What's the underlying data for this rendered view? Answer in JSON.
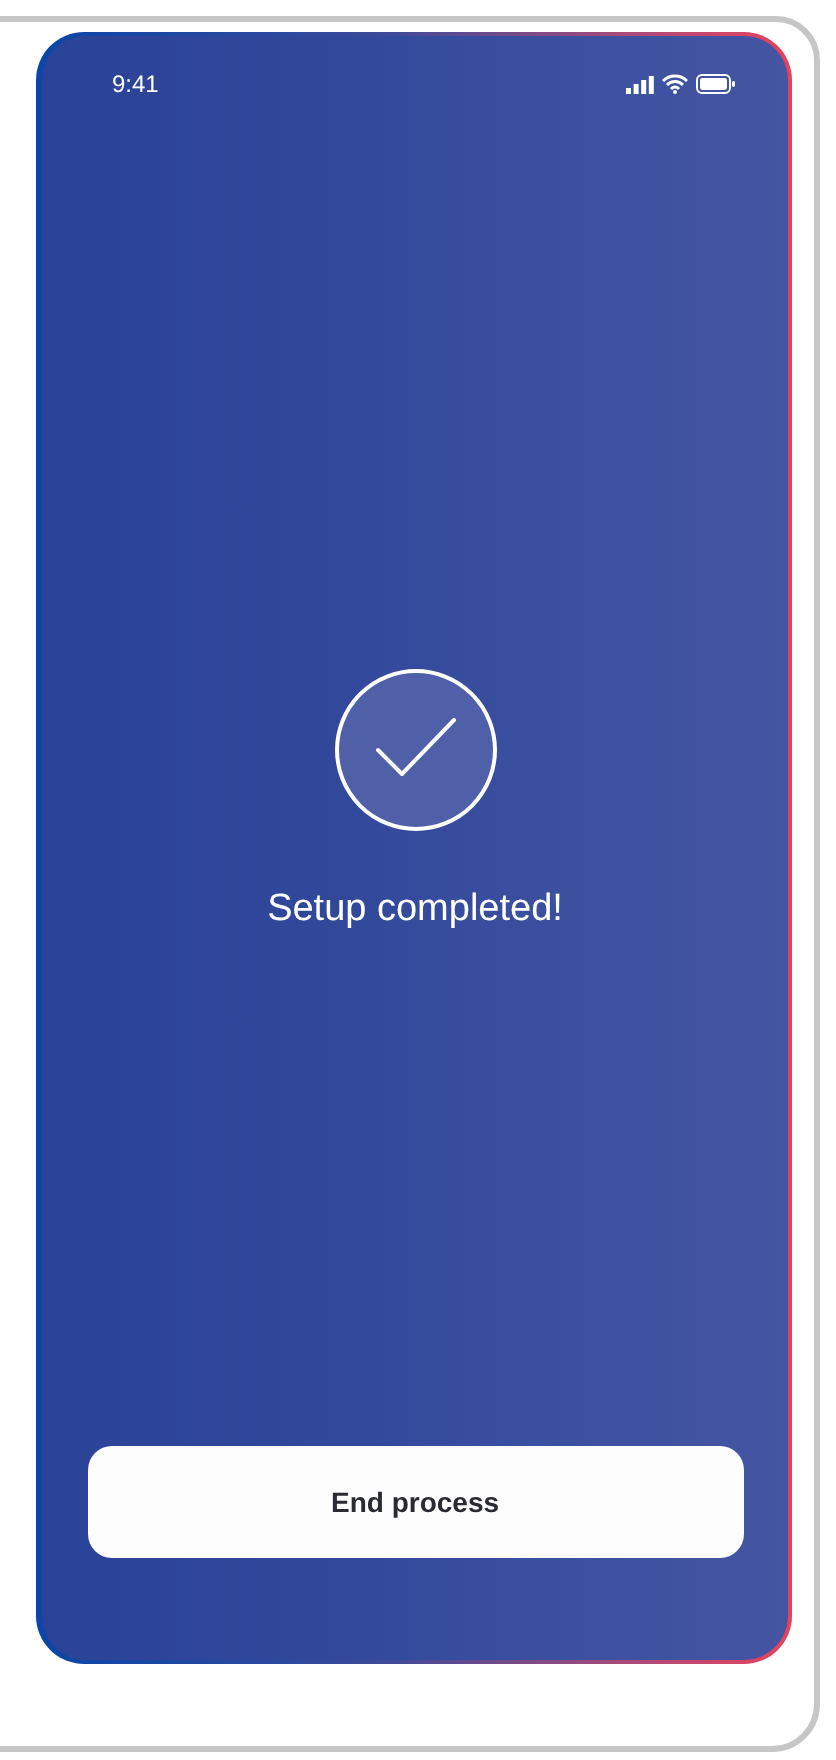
{
  "status_bar": {
    "time": "9:41"
  },
  "message": "Setup completed!",
  "button": {
    "label": "End process"
  }
}
